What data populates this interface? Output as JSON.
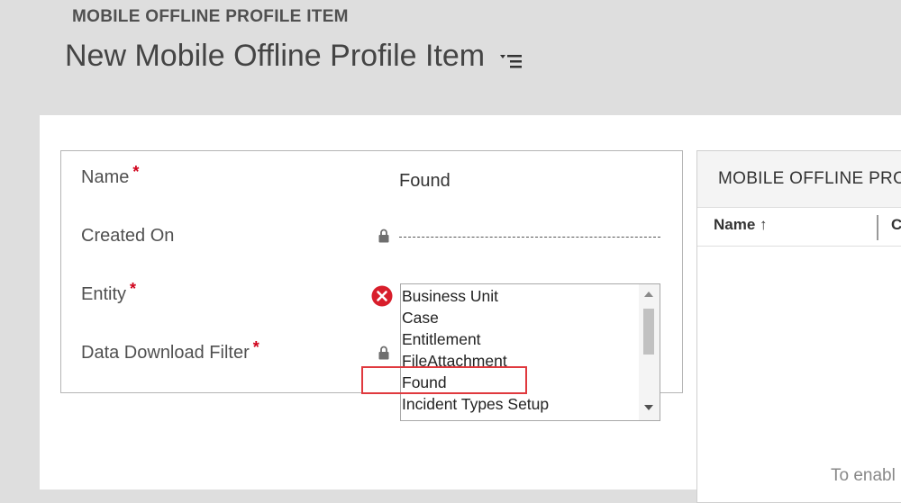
{
  "header": {
    "entity_name": "MOBILE OFFLINE PROFILE ITEM",
    "record_title": "New Mobile Offline Profile Item",
    "menu_icon": "dropdown-list-icon"
  },
  "form": {
    "name": {
      "label": "Name",
      "required": "*",
      "value": "Found"
    },
    "created_on": {
      "label": "Created On",
      "value": "---------------------------",
      "icon": "lock-icon"
    },
    "entity": {
      "label": "Entity",
      "required": "*",
      "icon": "error-icon",
      "options": [
        "Business Unit",
        "Case",
        "Entitlement",
        "FileAttachment",
        "Found",
        "Incident Types Setup"
      ],
      "selected": "Found"
    },
    "data_download_filter": {
      "label": "Data Download Filter",
      "required": "*",
      "icon": "lock-icon"
    }
  },
  "grid": {
    "title": "MOBILE OFFLINE PRO",
    "columns": [
      "Name ↑",
      "C"
    ],
    "empty_text": "To enabl"
  },
  "colors": {
    "required": "#d0021b",
    "highlight": "#e0393e",
    "error": "#d81e2b"
  }
}
